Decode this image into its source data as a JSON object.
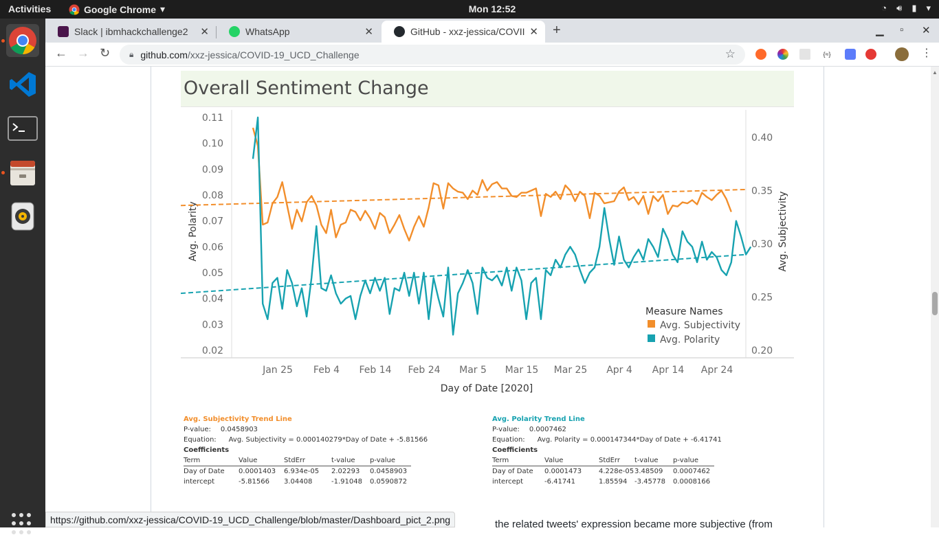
{
  "topbar": {
    "activities": "Activities",
    "app_name": "Google Chrome",
    "app_menu_icon": "chevron-down-icon",
    "clock": "Mon 12:52",
    "tray_icons": [
      "wifi-icon",
      "volume-icon",
      "battery-icon",
      "chevron-down-icon"
    ]
  },
  "dock": {
    "items": [
      "chrome-icon",
      "vscode-icon",
      "terminal-icon",
      "files-icon",
      "rhythmbox-icon"
    ],
    "apps_grid": "show-applications-icon"
  },
  "tabs": [
    {
      "title": "Slack | ibmhackchallenge2",
      "favicon_color": "#4a154b"
    },
    {
      "title": "WhatsApp",
      "favicon_color": "#25d366"
    },
    {
      "title": "GitHub - xxz-jessica/COVII",
      "favicon_color": "#24292e"
    }
  ],
  "toolbar": {
    "url_host": "github.com",
    "url_path": "/xxz-jessica/COVID-19_UCD_Challenge"
  },
  "dashboard": {
    "title": "Overall Sentiment Change"
  },
  "chart_data": {
    "type": "line",
    "xlabel": "Day of Date [2020]",
    "ylabel_left": "Avg. Polarity",
    "ylabel_right": "Avg. Subjectivity",
    "x_ticks": [
      "Jan 25",
      "Feb 4",
      "Feb 14",
      "Feb 24",
      "Mar 5",
      "Mar 15",
      "Mar 25",
      "Apr 4",
      "Apr 14",
      "Apr 24"
    ],
    "x_start": "2020-01-21",
    "y_left_ticks": [
      "0.11",
      "0.10",
      "0.09",
      "0.08",
      "0.07",
      "0.06",
      "0.05",
      "0.04",
      "0.03",
      "0.02"
    ],
    "y_left_range": [
      0.02,
      0.11
    ],
    "y_right_ticks": [
      "0.40",
      "0.35",
      "0.30",
      "0.25",
      "0.20"
    ],
    "y_right_range": [
      0.2,
      0.42
    ],
    "legend_title": "Measure Names",
    "legend_position": "bottom-right",
    "series": [
      {
        "name": "Avg. Subjectivity",
        "axis": "right",
        "color": "#f28e2b",
        "values": [
          0.409,
          0.392,
          0.318,
          0.32,
          0.338,
          0.344,
          0.358,
          0.336,
          0.314,
          0.332,
          0.321,
          0.339,
          0.345,
          0.336,
          0.318,
          0.31,
          0.332,
          0.306,
          0.318,
          0.32,
          0.332,
          0.33,
          0.322,
          0.331,
          0.324,
          0.314,
          0.329,
          0.325,
          0.31,
          0.318,
          0.327,
          0.314,
          0.303,
          0.316,
          0.326,
          0.316,
          0.334,
          0.357,
          0.355,
          0.333,
          0.357,
          0.352,
          0.349,
          0.348,
          0.342,
          0.35,
          0.346,
          0.36,
          0.35,
          0.356,
          0.358,
          0.352,
          0.352,
          0.345,
          0.344,
          0.348,
          0.348,
          0.35,
          0.352,
          0.326,
          0.347,
          0.344,
          0.349,
          0.342,
          0.355,
          0.35,
          0.34,
          0.349,
          0.345,
          0.324,
          0.348,
          0.345,
          0.338,
          0.339,
          0.34,
          0.349,
          0.353,
          0.341,
          0.344,
          0.337,
          0.345,
          0.328,
          0.345,
          0.34,
          0.346,
          0.328,
          0.336,
          0.335,
          0.339,
          0.338,
          0.341,
          0.337,
          0.348,
          0.344,
          0.341,
          0.346,
          0.35,
          0.342,
          0.33
        ]
      },
      {
        "name": "Avg. Polarity",
        "axis": "left",
        "color": "#17a2b0",
        "values": [
          0.094,
          0.11,
          0.038,
          0.032,
          0.046,
          0.048,
          0.036,
          0.051,
          0.046,
          0.037,
          0.044,
          0.033,
          0.048,
          0.068,
          0.044,
          0.043,
          0.049,
          0.042,
          0.038,
          0.04,
          0.041,
          0.032,
          0.041,
          0.047,
          0.042,
          0.048,
          0.043,
          0.048,
          0.034,
          0.044,
          0.043,
          0.05,
          0.041,
          0.05,
          0.038,
          0.05,
          0.032,
          0.048,
          0.04,
          0.033,
          0.052,
          0.026,
          0.042,
          0.046,
          0.051,
          0.046,
          0.034,
          0.052,
          0.048,
          0.047,
          0.049,
          0.045,
          0.052,
          0.043,
          0.052,
          0.047,
          0.032,
          0.046,
          0.048,
          0.032,
          0.051,
          0.049,
          0.055,
          0.052,
          0.057,
          0.06,
          0.057,
          0.051,
          0.046,
          0.05,
          0.052,
          0.06,
          0.075,
          0.063,
          0.053,
          0.064,
          0.055,
          0.052,
          0.056,
          0.059,
          0.055,
          0.063,
          0.06,
          0.056,
          0.067,
          0.063,
          0.057,
          0.054,
          0.066,
          0.062,
          0.06,
          0.054,
          0.062,
          0.055,
          0.058,
          0.056,
          0.051,
          0.049,
          0.054,
          0.07,
          0.064,
          0.057,
          0.06
        ]
      }
    ],
    "trend_lines": [
      {
        "series": "Avg. Subjectivity",
        "start": 0.336,
        "end": 0.351
      },
      {
        "series": "Avg. Polarity",
        "start": 0.042,
        "end": 0.057
      }
    ]
  },
  "trend_subjectivity": {
    "title": "Avg. Subjectivity Trend Line",
    "pvalue_label": "P-value:",
    "pvalue": "0.0458903",
    "equation_label": "Equation:",
    "equation": "Avg. Subjectivity = 0.000140279*Day of Date + -5.81566",
    "coefficients": "Coefficients",
    "headers": [
      "Term",
      "Value",
      "StdErr",
      "t-value",
      "p-value"
    ],
    "rows": [
      [
        "Day of Date",
        "0.0001403",
        "6.934e-05",
        "2.02293",
        "0.0458903"
      ],
      [
        "intercept",
        "-5.81566",
        "3.04408",
        "-1.91048",
        "0.0590872"
      ]
    ]
  },
  "trend_polarity": {
    "title": "Avg. Polarity Trend Line",
    "pvalue_label": "P-value:",
    "pvalue": "0.0007462",
    "equation_label": "Equation:",
    "equation": "Avg. Polarity = 0.000147344*Day of Date + -6.41741",
    "coefficients": "Coefficients",
    "headers": [
      "Term",
      "Value",
      "StdErr",
      "t-value",
      "p-value"
    ],
    "rows": [
      [
        "Day of Date",
        "0.0001473",
        "4.228e-05",
        "3.48509",
        "0.0007462"
      ],
      [
        "intercept",
        "-6.41741",
        "1.85594",
        "-3.45778",
        "0.0008166"
      ]
    ]
  },
  "status_url": "https://github.com/xxz-jessica/COVID-19_UCD_Challenge/blob/master/Dashboard_pict_2.png",
  "peek_text": "the related tweets' expression became more subjective (from"
}
